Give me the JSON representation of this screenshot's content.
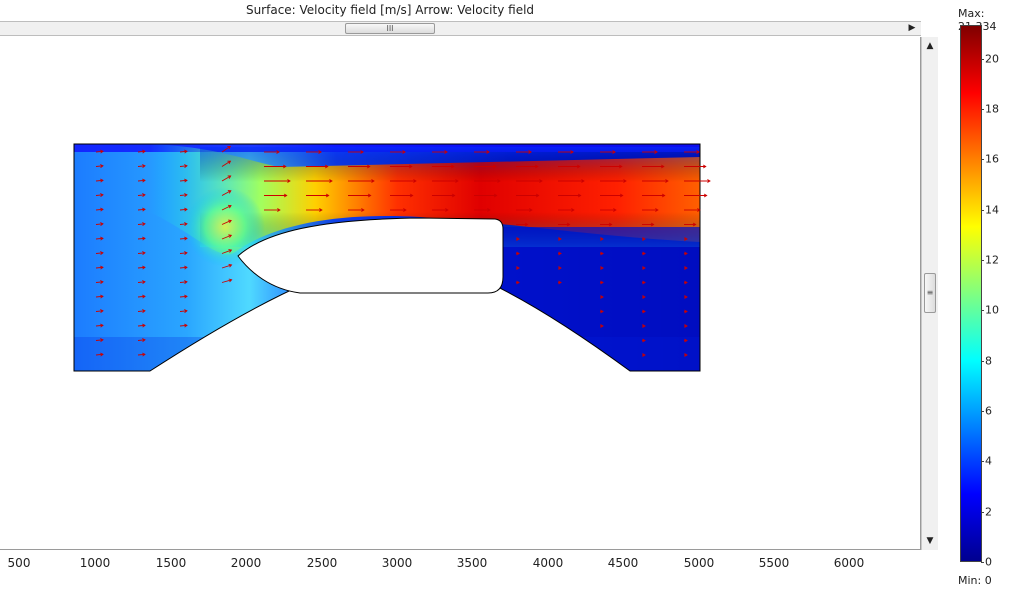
{
  "title": "Surface: Velocity field [m/s]   Arrow: Velocity field",
  "scrollbar": {
    "grip": "III"
  },
  "x_axis": {
    "ticks": [
      "500",
      "1000",
      "1500",
      "2000",
      "2500",
      "3000",
      "3500",
      "4000",
      "4500",
      "5000",
      "5500",
      "6000"
    ]
  },
  "legend": {
    "max_label": "Max: 21.334",
    "min_label": "Min: 0",
    "ticks": [
      "0",
      "2",
      "4",
      "6",
      "8",
      "10",
      "12",
      "14",
      "16",
      "18",
      "20"
    ],
    "max_value": 21.334,
    "min_value": 0
  },
  "colors": {
    "low": "#00008f",
    "mid": "#80ff80",
    "high": "#800000",
    "arrow": "#cc0000"
  },
  "icons": [
    "scroll-right-arrow-icon",
    "scroll-up-arrow-icon",
    "scroll-down-arrow-icon",
    "scroll-grip-icon"
  ]
}
